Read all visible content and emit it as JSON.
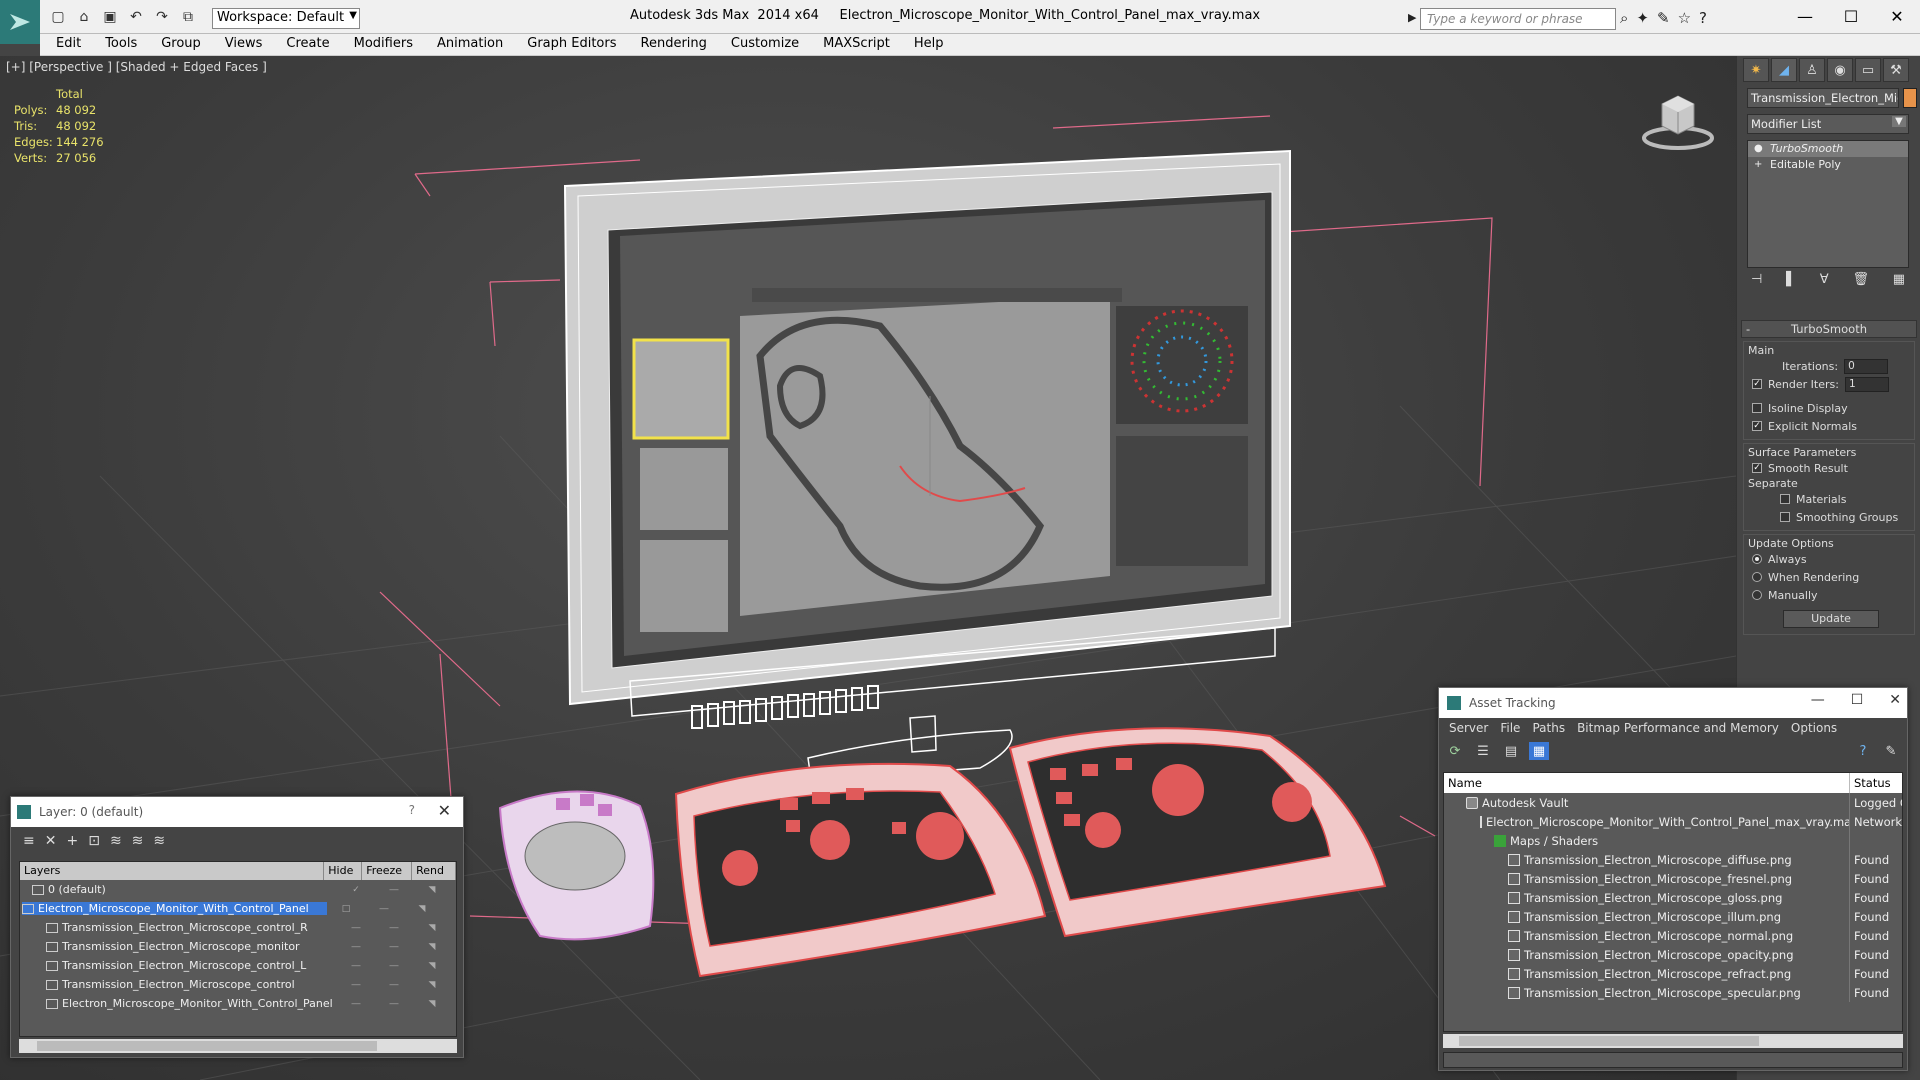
{
  "app": {
    "title": "Autodesk 3ds Max  2014 x64     Electron_Microscope_Monitor_With_Control_Panel_max_vray.max",
    "workspace": "Workspace: Default",
    "search_placeholder": "Type a keyword or phrase"
  },
  "menu": [
    "Edit",
    "Tools",
    "Group",
    "Views",
    "Create",
    "Modifiers",
    "Animation",
    "Graph Editors",
    "Rendering",
    "Customize",
    "MAXScript",
    "Help"
  ],
  "viewport": {
    "label": "[+] [Perspective ] [Shaded + Edged Faces ]",
    "stats": {
      "total_label": "Total",
      "rows": [
        {
          "k": "Polys:",
          "v": "48 092"
        },
        {
          "k": "Tris:",
          "v": "48 092"
        },
        {
          "k": "Edges:",
          "v": "144 276"
        },
        {
          "k": "Verts:",
          "v": "27 056"
        }
      ]
    }
  },
  "command_panel": {
    "object_name": "Transmission_Electron_Micros",
    "modifier_list": "Modifier List",
    "stack": [
      {
        "label": "TurboSmooth",
        "selected": true
      },
      {
        "label": "Editable Poly",
        "selected": false
      }
    ],
    "turbosmooth": {
      "title": "TurboSmooth",
      "main_label": "Main",
      "iterations_label": "Iterations:",
      "iterations_value": "0",
      "render_iters_label": "Render Iters:",
      "render_iters_value": "1",
      "isoline_label": "Isoline Display",
      "explicit_normals_label": "Explicit Normals",
      "surface_label": "Surface Parameters",
      "smooth_result_label": "Smooth Result",
      "separate_label": "Separate",
      "materials_label": "Materials",
      "smoothing_groups_label": "Smoothing Groups",
      "update_options_label": "Update Options",
      "always_label": "Always",
      "when_rendering_label": "When Rendering",
      "manually_label": "Manually",
      "update_button": "Update"
    }
  },
  "layer_dialog": {
    "title": "Layer: 0 (default)",
    "help": "?",
    "columns": [
      "Layers",
      "Hide",
      "Freeze",
      "Rend"
    ],
    "rows": [
      {
        "name": "0 (default)",
        "indent": 1,
        "selected": false
      },
      {
        "name": "Electron_Microscope_Monitor_With_Control_Panel",
        "indent": 0,
        "selected": true
      },
      {
        "name": "Transmission_Electron_Microscope_control_R",
        "indent": 2,
        "selected": false
      },
      {
        "name": "Transmission_Electron_Microscope_monitor",
        "indent": 2,
        "selected": false
      },
      {
        "name": "Transmission_Electron_Microscope_control_L",
        "indent": 2,
        "selected": false
      },
      {
        "name": "Transmission_Electron_Microscope_control",
        "indent": 2,
        "selected": false
      },
      {
        "name": "Electron_Microscope_Monitor_With_Control_Panel",
        "indent": 2,
        "selected": false
      }
    ]
  },
  "asset_dialog": {
    "title": "Asset Tracking",
    "menu": [
      "Server",
      "File",
      "Paths",
      "Bitmap Performance and Memory",
      "Options"
    ],
    "columns": [
      "Name",
      "Status"
    ],
    "rows": [
      {
        "name": "Autodesk Vault",
        "status": "Logged O",
        "indent": 1,
        "type": "vault"
      },
      {
        "name": "Electron_Microscope_Monitor_With_Control_Panel_max_vray.max",
        "status": "Network",
        "indent": 2,
        "type": "file"
      },
      {
        "name": "Maps / Shaders",
        "status": "",
        "indent": 3,
        "type": "map"
      },
      {
        "name": "Transmission_Electron_Microscope_diffuse.png",
        "status": "Found",
        "indent": 4,
        "type": "file"
      },
      {
        "name": "Transmission_Electron_Microscope_fresnel.png",
        "status": "Found",
        "indent": 4,
        "type": "file"
      },
      {
        "name": "Transmission_Electron_Microscope_gloss.png",
        "status": "Found",
        "indent": 4,
        "type": "file"
      },
      {
        "name": "Transmission_Electron_Microscope_illum.png",
        "status": "Found",
        "indent": 4,
        "type": "file"
      },
      {
        "name": "Transmission_Electron_Microscope_normal.png",
        "status": "Found",
        "indent": 4,
        "type": "file"
      },
      {
        "name": "Transmission_Electron_Microscope_opacity.png",
        "status": "Found",
        "indent": 4,
        "type": "file"
      },
      {
        "name": "Transmission_Electron_Microscope_refract.png",
        "status": "Found",
        "indent": 4,
        "type": "file"
      },
      {
        "name": "Transmission_Electron_Microscope_specular.png",
        "status": "Found",
        "indent": 4,
        "type": "file"
      }
    ]
  },
  "colors": {
    "accent": "#2c7a78",
    "selection": "#3a78d6",
    "stats_text": "#e9e36a",
    "wire_red": "#e04a4a",
    "bbox_pink": "#e06a8a"
  }
}
